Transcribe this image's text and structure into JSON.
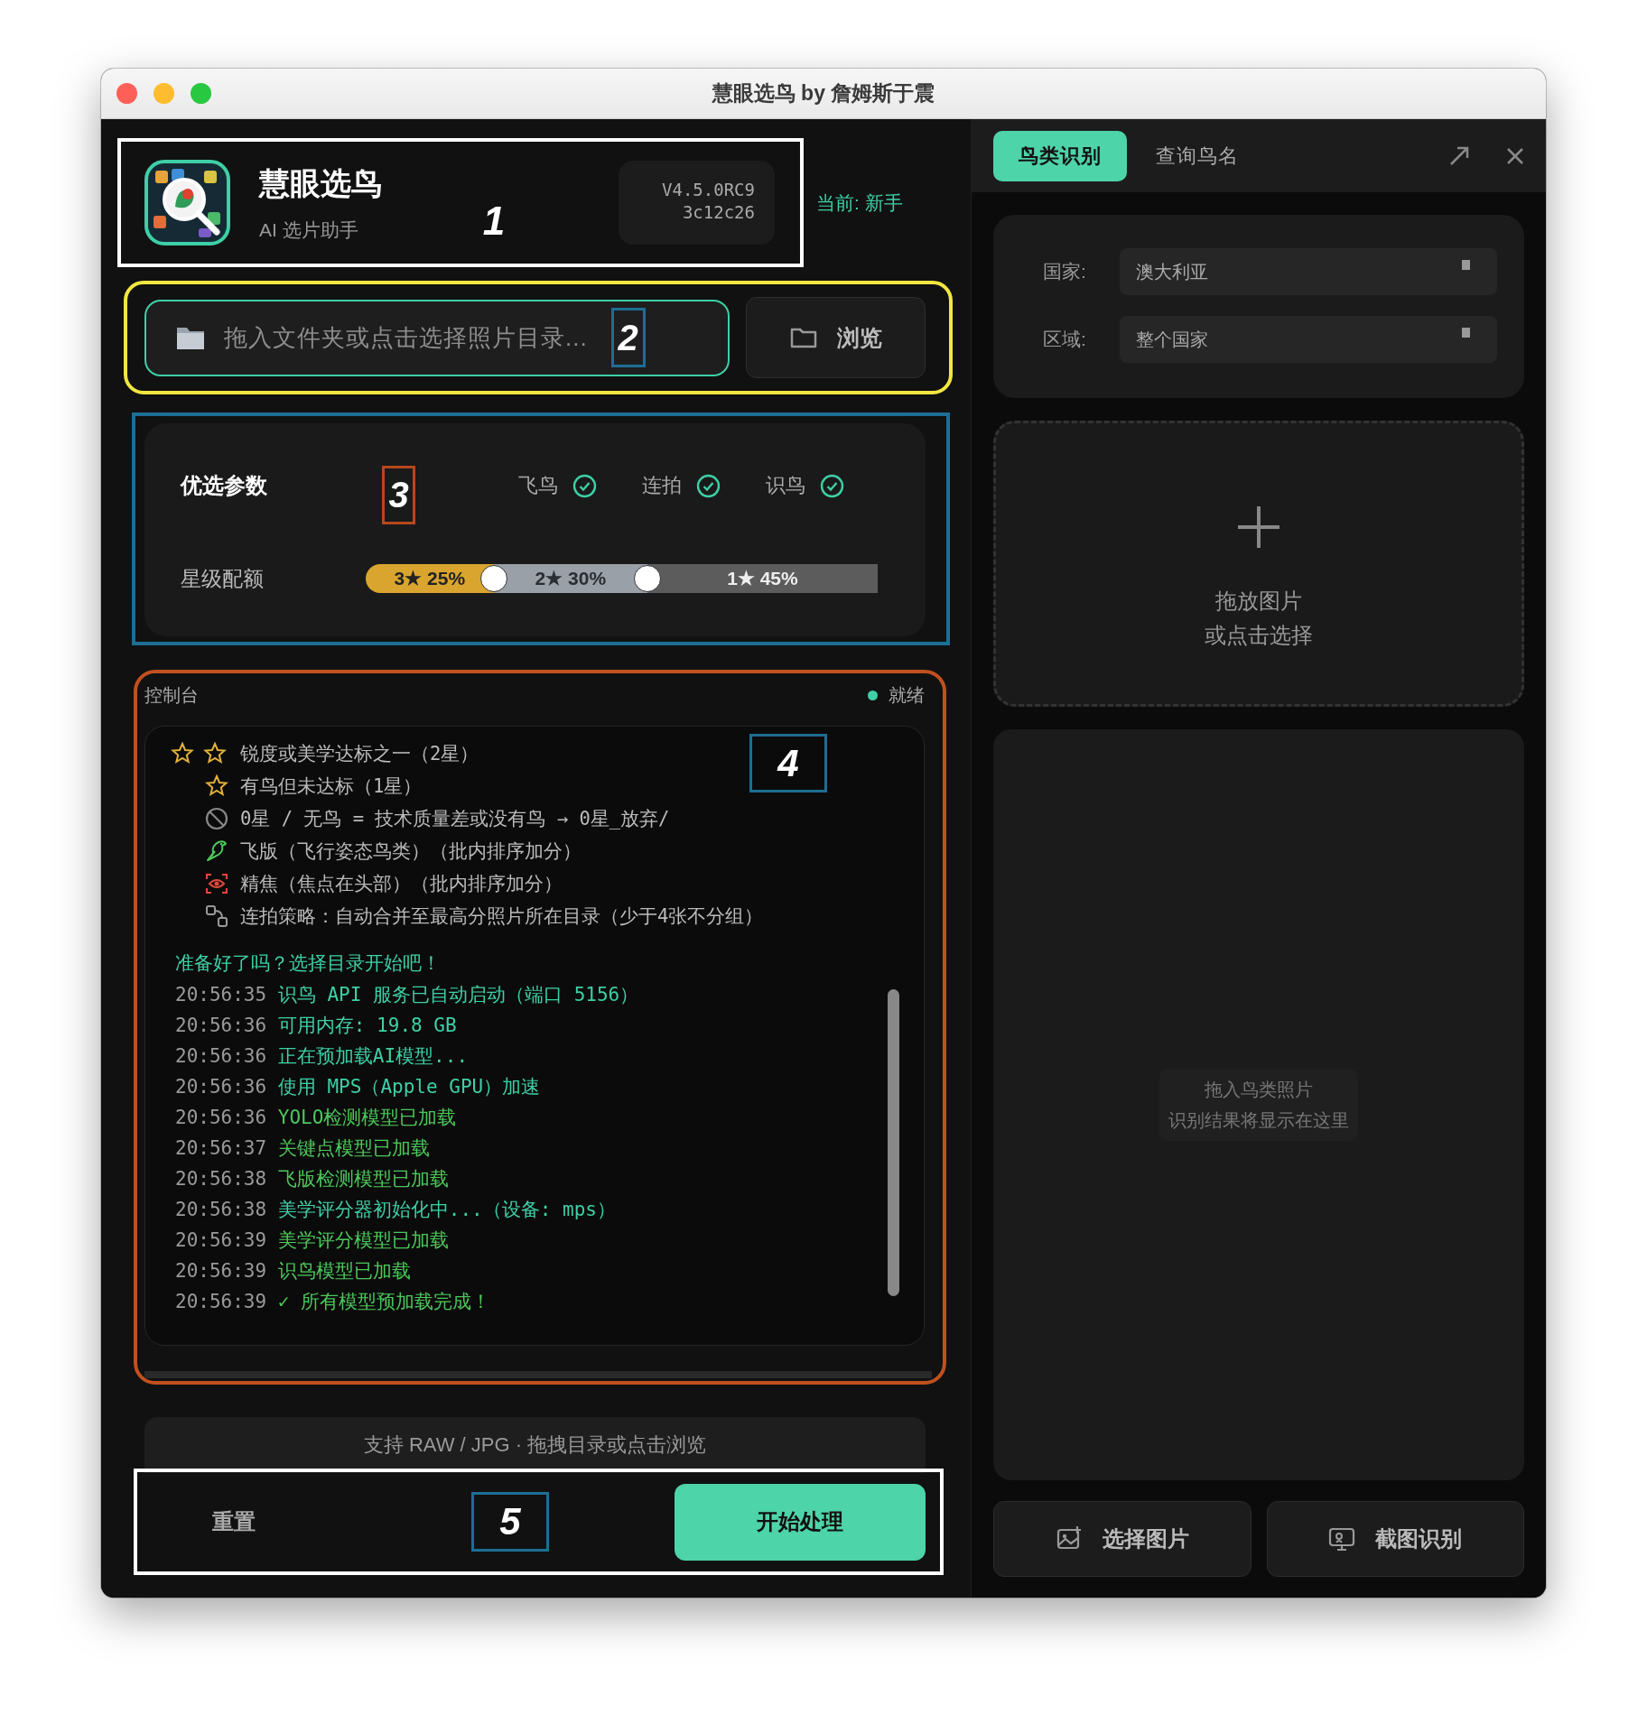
{
  "window": {
    "title": "慧眼选鸟 by 詹姆斯于震"
  },
  "header": {
    "app_name": "慧眼选鸟",
    "subtitle": "AI 选片助手",
    "version": "V4.5.0RC9",
    "build": "3c12c26",
    "mode": "当前: 新手",
    "callout": {
      "label": "1",
      "color": "#ffffff"
    }
  },
  "folder": {
    "placeholder": "拖入文件夹或点击选择照片目录...",
    "browse": "浏览",
    "callout": {
      "label": "2",
      "color": "#f2e640",
      "tag": {
        "color": "#1d6e94"
      }
    }
  },
  "params": {
    "title": "优选参数",
    "options": [
      {
        "label": "飞鸟",
        "checked": true
      },
      {
        "label": "连拍",
        "checked": true
      },
      {
        "label": "识鸟",
        "checked": true
      }
    ],
    "quota_label": "星级配额",
    "quota": {
      "segments": [
        "3★ 25%",
        "2★ 30%",
        "1★ 45%"
      ],
      "thumbs": [
        {
          "level": 0.25
        },
        {
          "level": 0.55
        }
      ]
    },
    "callout": {
      "label": "3",
      "color": "#1d6e94",
      "tag": {
        "color": "#b8471c"
      }
    }
  },
  "console": {
    "title": "控制台",
    "status": "就绪",
    "legend": [
      {
        "kind": "two-star",
        "text": "锐度或美学达标之一（2星）"
      },
      {
        "kind": "one-star",
        "text": "有鸟但未达标（1星）"
      },
      {
        "kind": "none",
        "text": "0星 / 无鸟 = 技术质量差或没有鸟 → 0星_放弃/"
      },
      {
        "kind": "flight",
        "text": "飞版（飞行姿态鸟类）（批内排序加分）"
      },
      {
        "kind": "focus",
        "text": "精焦（焦点在头部）（批内排序加分）"
      },
      {
        "kind": "burst",
        "text": "连拍策略：自动合并至最高分照片所在目录（少于4张不分组）"
      }
    ],
    "prompt": "准备好了吗？选择目录开始吧！",
    "log": [
      {
        "time": "20:56:35",
        "message": "识鸟 API 服务已自动启动（端口 5156）",
        "kind": "info"
      },
      {
        "time": "20:56:36",
        "message": "可用内存: 19.8 GB",
        "kind": "info"
      },
      {
        "time": "20:56:36",
        "message": "正在预加载AI模型...",
        "kind": "info"
      },
      {
        "time": "20:56:36",
        "message": "使用 MPS（Apple GPU）加速",
        "kind": "info"
      },
      {
        "time": "20:56:36",
        "message": "YOLO检测模型已加载",
        "kind": "success"
      },
      {
        "time": "20:56:37",
        "message": "关键点模型已加载",
        "kind": "success"
      },
      {
        "time": "20:56:38",
        "message": "飞版检测模型已加载",
        "kind": "success"
      },
      {
        "time": "20:56:38",
        "message": "美学评分器初始化中...（设备: mps）",
        "kind": "info"
      },
      {
        "time": "20:56:39",
        "message": "美学评分模型已加载",
        "kind": "success"
      },
      {
        "time": "20:56:39",
        "message": "识鸟模型已加载",
        "kind": "success"
      },
      {
        "time": "20:56:39",
        "message": "✓ 所有模型预加载完成！",
        "kind": "success"
      }
    ],
    "callout": {
      "label": "4",
      "color": "#c0501e",
      "tag": {
        "color": "#1d6e94"
      }
    }
  },
  "hint": "支持 RAW / JPG · 拖拽目录或点击浏览",
  "actions": {
    "reset": "重置",
    "start": "开始处理",
    "callout": {
      "label": "5",
      "color": "#ffffff",
      "tag": {
        "color": "#1d6e94"
      }
    }
  },
  "right": {
    "tabs": [
      {
        "label": "鸟类识别",
        "selected": true
      },
      {
        "label": "查询鸟名",
        "selected": false
      }
    ],
    "filters": [
      {
        "label": "国家:",
        "value": "澳大利亚"
      },
      {
        "label": "区域:",
        "value": "整个国家"
      }
    ],
    "drop": [
      "拖放图片",
      "或点击选择"
    ],
    "result": [
      "拖入鸟类照片",
      "识别结果将显示在这里"
    ],
    "buttons": [
      {
        "label": "选择图片",
        "kind": "image"
      },
      {
        "label": "截图识别",
        "kind": "screenshot"
      }
    ]
  }
}
